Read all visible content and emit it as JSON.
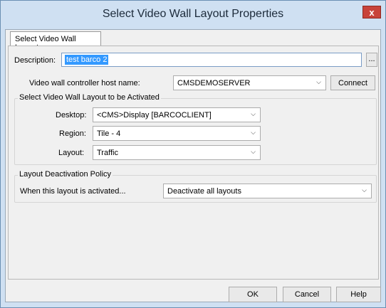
{
  "window": {
    "title": "Select Video Wall Layout Properties",
    "close_label": "x"
  },
  "tab": {
    "label": "Select Video Wall Layout"
  },
  "description": {
    "label": "Description:",
    "value": "test barco 2",
    "browse_label": "..."
  },
  "host": {
    "label": "Video wall controller host name:",
    "value": "CMSDEMOSERVER",
    "connect_label": "Connect"
  },
  "activation_group": {
    "title": "Select Video Wall Layout to be Activated",
    "desktop": {
      "label": "Desktop:",
      "value": "<CMS>Display [BARCOCLIENT]"
    },
    "region": {
      "label": "Region:",
      "value": "Tile - 4"
    },
    "layout": {
      "label": "Layout:",
      "value": "Traffic"
    }
  },
  "deactivation_group": {
    "title": "Layout Deactivation Policy",
    "label": "When this layout is activated...",
    "value": "Deactivate all layouts"
  },
  "footer": {
    "ok_label": "OK",
    "cancel_label": "Cancel",
    "help_label": "Help"
  },
  "icons": {
    "dropdown": "chevron-down-icon",
    "close": "close-icon"
  }
}
